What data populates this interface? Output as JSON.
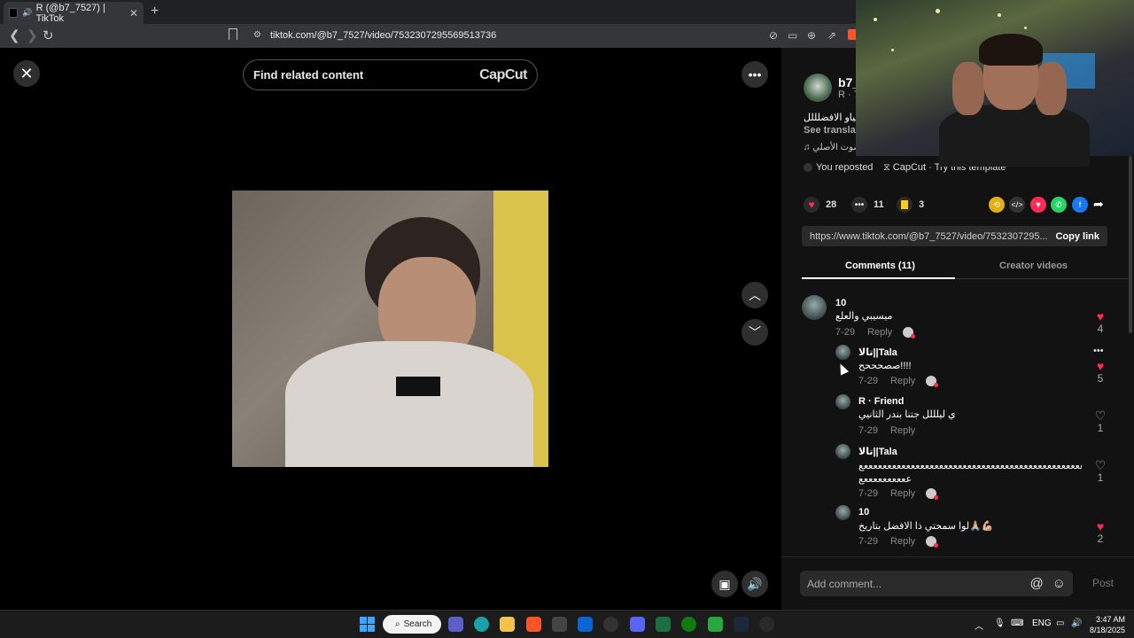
{
  "browser": {
    "tab_title": "R (@b7_7527) | TikTok",
    "new_tab": "+",
    "url": "tiktok.com/@b7_7527/video/7532307295569513736"
  },
  "video": {
    "search_placeholder": "Find related content",
    "capcut_logo": "CapCut"
  },
  "post": {
    "username": "b7_",
    "subline": "R · 7",
    "caption": "خياو الافضلللل",
    "see_translation": "See translat",
    "sound": "صوت الأصلي",
    "reposted": "You reposted",
    "capcut": "CapCut · Try this template"
  },
  "stats": {
    "likes": "28",
    "comments": "11",
    "saves": "3"
  },
  "link": {
    "url": "https://www.tiktok.com/@b7_7527/video/7532307295...",
    "copy": "Copy link"
  },
  "tabs": {
    "comments": "Comments (11)",
    "creator": "Creator videos"
  },
  "comments": [
    {
      "name": "10",
      "text": "ميسيبي والعلع",
      "date": "7-29",
      "reply": "Reply",
      "likes": "4"
    },
    {
      "name": "تالا||Tala",
      "text": "صصحححح!!!!",
      "date": "7-29",
      "reply": "Reply",
      "likes": "5"
    },
    {
      "name": "R · Friend",
      "text": "ي ليلللل جتنا بندر الثانيي",
      "date": "7-29",
      "reply": "Reply",
      "likes": "1"
    },
    {
      "name": "تالا||Tala",
      "text": "ععععععععععععععععععععععععععععععععععععععععععععععععععععععععع",
      "text2": "ععععععععععع",
      "date": "7-29",
      "reply": "Reply",
      "likes": "1"
    },
    {
      "name": "10",
      "text": "لوا سمحتي ذا الافضل بتاريخ🙏🏼💪🏼",
      "date": "7-29",
      "reply": "Reply",
      "likes": "2"
    }
  ],
  "comment_bar": {
    "placeholder": "Add comment...",
    "post": "Post"
  },
  "taskbar": {
    "search": "Search",
    "lang": "ENG",
    "time": "3:47 AM",
    "date": "8/18/2025"
  },
  "colors": {
    "accent": "#fe2c55",
    "panel_bg": "#121212",
    "save_yellow": "#facc15"
  }
}
